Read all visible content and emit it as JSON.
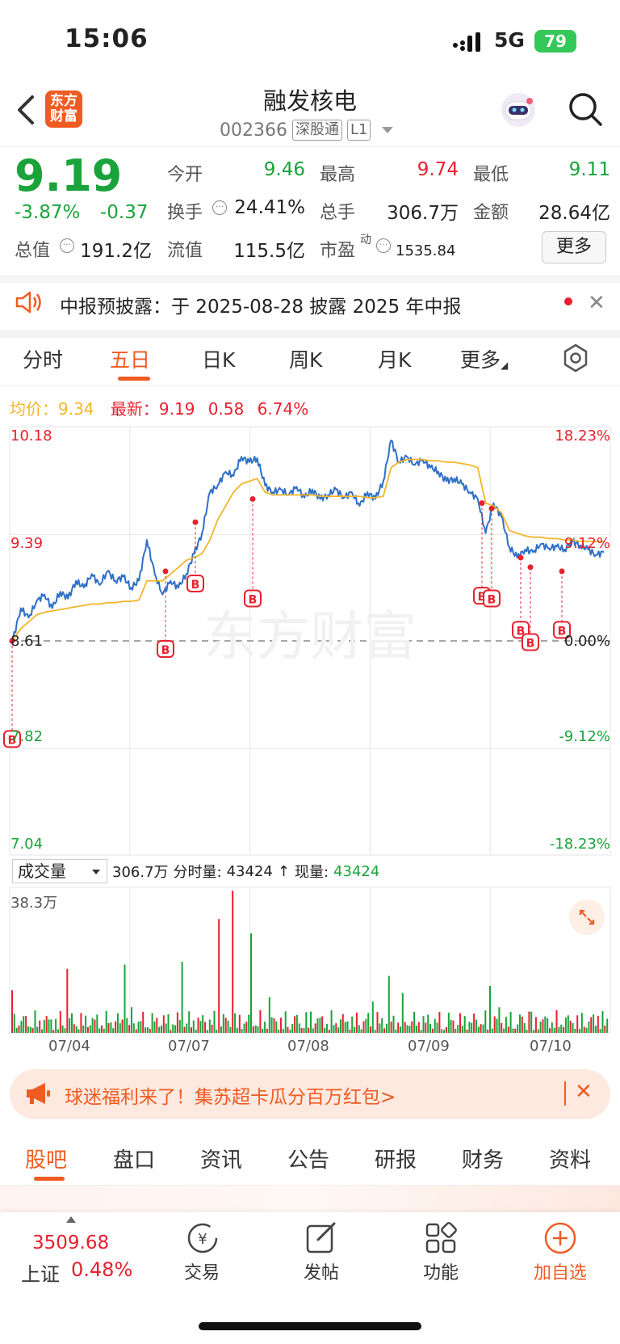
{
  "status_bar": {
    "time": "15:06",
    "network": "5G",
    "battery": "79"
  },
  "header": {
    "logo_text": "东方财富",
    "stock_name": "融发核电",
    "stock_code": "002366",
    "tag1": "深股通",
    "tag2": "L1"
  },
  "quote": {
    "price": "9.19",
    "change_pct": "-3.87%",
    "change_amt": "-0.37",
    "fields": {
      "open_label": "今开",
      "open_value": "9.46",
      "high_label": "最高",
      "high_value": "9.74",
      "low_label": "最低",
      "low_value": "9.11",
      "turnover_label": "换手",
      "turnover_value": "24.41%",
      "volume_label": "总手",
      "volume_value": "306.7万",
      "amount_label": "金额",
      "amount_value": "28.64亿",
      "mktcap_label": "总值",
      "mktcap_value": "191.2亿",
      "float_label": "流值",
      "float_value": "115.5亿",
      "pe_label": "市盈",
      "pe_sup": "动",
      "pe_value": "1535.84"
    },
    "more_label": "更多"
  },
  "notice": {
    "text": "中报预披露：于 2025-08-28 披露 2025 年中报"
  },
  "chart_tabs": [
    "分时",
    "五日",
    "日K",
    "周K",
    "月K",
    "更多"
  ],
  "chart_legend": {
    "avg_label": "均价：",
    "avg_value": "9.34",
    "latest_label": "最新：",
    "latest_value": "9.19",
    "latest_chg": "0.58",
    "latest_pct": "6.74%"
  },
  "chart_data": {
    "type": "line",
    "title": "",
    "x_dates": [
      "07/04",
      "07/07",
      "07/08",
      "07/09",
      "07/10"
    ],
    "ylim": [
      7.04,
      10.18
    ],
    "y_ticks_left": [
      "10.18",
      "9.39",
      "8.61",
      "7.82",
      "7.04"
    ],
    "y_ticks_right": [
      "18.23%",
      "9.12%",
      "0.00%",
      "-9.12%",
      "-18.23%"
    ],
    "prev_close": 8.61,
    "watermark": "东方财富",
    "series": [
      {
        "name": "price",
        "color": "#2f6fc7",
        "values": [
          8.62,
          8.85,
          8.78,
          8.9,
          8.95,
          8.85,
          8.97,
          8.92,
          9.05,
          9.0,
          9.1,
          9.02,
          9.12,
          9.05,
          9.08,
          9.0,
          9.05,
          9.35,
          9.1,
          8.95,
          9.05,
          9.0,
          9.1,
          9.25,
          9.4,
          9.7,
          9.75,
          9.85,
          9.82,
          9.96,
          9.92,
          9.95,
          9.75,
          9.7,
          9.72,
          9.68,
          9.74,
          9.66,
          9.72,
          9.65,
          9.68,
          9.72,
          9.66,
          9.7,
          9.6,
          9.7,
          9.65,
          9.78,
          10.08,
          9.92,
          9.96,
          9.9,
          9.94,
          9.88,
          9.85,
          9.78,
          9.8,
          9.76,
          9.7,
          9.65,
          9.4,
          9.62,
          9.52,
          9.3,
          9.22,
          9.28,
          9.26,
          9.32,
          9.29,
          9.3,
          9.28,
          9.34,
          9.31,
          9.28,
          9.24,
          9.26
        ]
      },
      {
        "name": "avg",
        "color": "#f3b52a",
        "values": [
          8.62,
          8.7,
          8.75,
          8.8,
          8.82,
          8.83,
          8.84,
          8.85,
          8.86,
          8.87,
          8.88,
          8.88,
          8.89,
          8.89,
          8.9,
          8.9,
          8.91,
          9.05,
          9.05,
          9.05,
          9.1,
          9.15,
          9.2,
          9.22,
          9.25,
          9.35,
          9.5,
          9.6,
          9.7,
          9.76,
          9.78,
          9.8,
          9.7,
          9.68,
          9.68,
          9.68,
          9.68,
          9.68,
          9.68,
          9.67,
          9.67,
          9.67,
          9.67,
          9.67,
          9.67,
          9.66,
          9.66,
          9.67,
          9.88,
          9.92,
          9.94,
          9.94,
          9.94,
          9.93,
          9.93,
          9.92,
          9.92,
          9.91,
          9.9,
          9.88,
          9.62,
          9.6,
          9.55,
          9.42,
          9.4,
          9.38,
          9.37,
          9.37,
          9.36,
          9.36,
          9.35,
          9.35,
          9.34,
          9.34,
          9.34,
          9.34
        ]
      }
    ],
    "buy_markers": [
      "B",
      "B",
      "B",
      "B",
      "B",
      "B",
      "B",
      "B",
      "B",
      "B"
    ]
  },
  "volume": {
    "selector_label": "成交量",
    "total": "306.7万",
    "tick_label": "分时量:",
    "tick_value": "43424",
    "arrow": "↑",
    "now_label": "现量:",
    "now_value": "43424",
    "max_label": "38.3万"
  },
  "promo": {
    "text": "球迷福利来了！集苏超卡瓜分百万红包>"
  },
  "section_tabs": [
    "股吧",
    "盘口",
    "资讯",
    "公告",
    "研报",
    "财务",
    "资料"
  ],
  "bottom_bar": {
    "index_value": "3509.68",
    "index_name": "上证",
    "index_pct": "0.48%",
    "items": [
      "交易",
      "发帖",
      "功能",
      "加自选"
    ]
  }
}
